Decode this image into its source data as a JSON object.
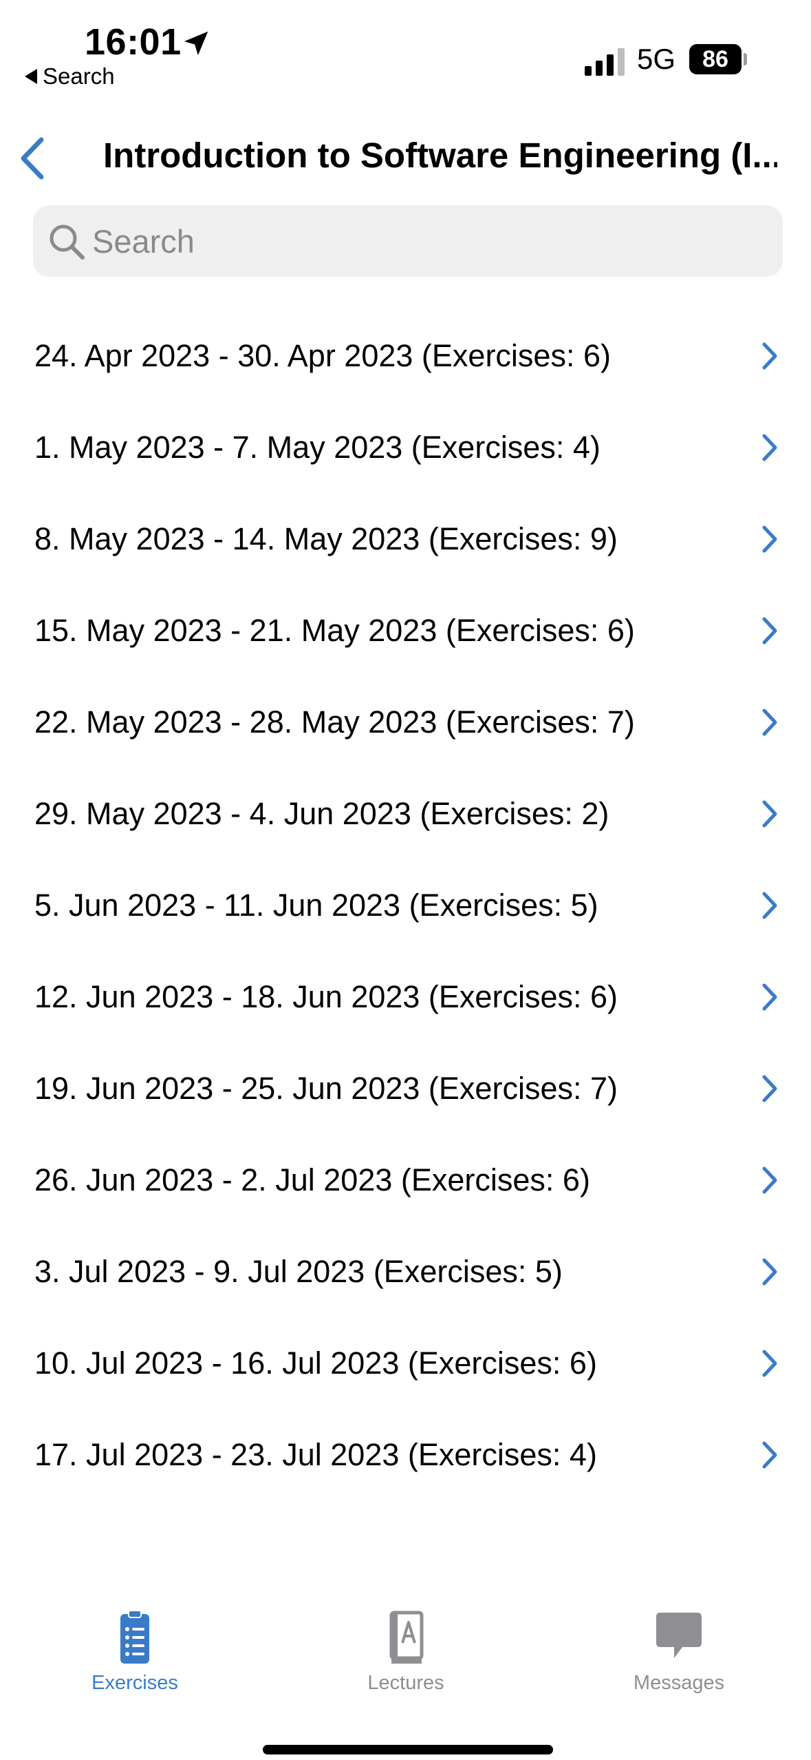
{
  "status_bar": {
    "time": "16:01",
    "back_app_label": "Search",
    "network": "5G",
    "battery": "86"
  },
  "nav": {
    "title": "Introduction to Software Engineering (I..."
  },
  "search": {
    "placeholder": "Search"
  },
  "weeks": [
    {
      "label": "24. Apr 2023 - 30. Apr 2023 (Exercises: 6)"
    },
    {
      "label": "1. May 2023 - 7. May 2023 (Exercises: 4)"
    },
    {
      "label": "8. May 2023 - 14. May 2023 (Exercises: 9)"
    },
    {
      "label": "15. May 2023 - 21. May 2023 (Exercises: 6)"
    },
    {
      "label": "22. May 2023 - 28. May 2023 (Exercises: 7)"
    },
    {
      "label": "29. May 2023 - 4. Jun 2023 (Exercises: 2)"
    },
    {
      "label": "5. Jun 2023 - 11. Jun 2023 (Exercises: 5)"
    },
    {
      "label": "12. Jun 2023 - 18. Jun 2023 (Exercises: 6)"
    },
    {
      "label": "19. Jun 2023 - 25. Jun 2023 (Exercises: 7)"
    },
    {
      "label": "26. Jun 2023 - 2. Jul 2023 (Exercises: 6)"
    },
    {
      "label": "3. Jul 2023 - 9. Jul 2023 (Exercises: 5)"
    },
    {
      "label": "10. Jul 2023 - 16. Jul 2023 (Exercises: 6)"
    },
    {
      "label": "17. Jul 2023 - 23. Jul 2023 (Exercises: 4)"
    }
  ],
  "tabs": [
    {
      "label": "Exercises",
      "icon": "clipboard-list-icon",
      "selected": true
    },
    {
      "label": "Lectures",
      "icon": "book-icon",
      "selected": false
    },
    {
      "label": "Messages",
      "icon": "chat-bubble-icon",
      "selected": false
    }
  ],
  "colors": {
    "accent": "#3a7bc8",
    "inactive_tab": "#8e8e93",
    "search_bg": "#efeff0"
  }
}
